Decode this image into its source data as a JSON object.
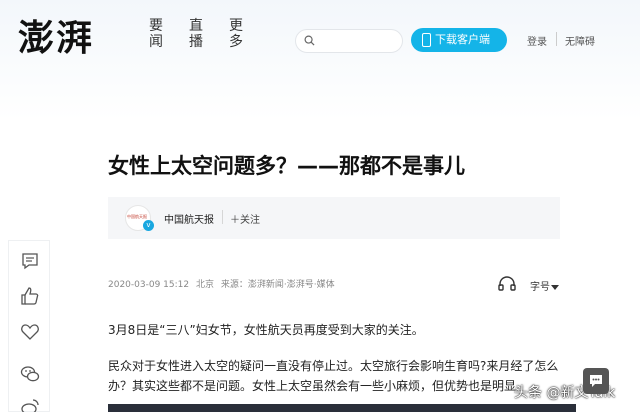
{
  "header": {
    "logo": "澎湃",
    "nav": [
      {
        "label": "要闻"
      },
      {
        "label": "直播"
      },
      {
        "label": "更多"
      }
    ],
    "search_placeholder": "",
    "download_label": "下载客户端",
    "login_label": "登录",
    "accessibility_label": "无障碍",
    "accent_color": "#14b4e8"
  },
  "article": {
    "title": "女性上太空问题多？——那都不是事儿",
    "author": {
      "name": "中国航天报",
      "avatar_text": "中国航天报",
      "follow_label": "关注"
    },
    "meta": {
      "datetime": "2020-03-09 15:12",
      "location": "北京",
      "source": "来源：澎湃新闻·澎湃号·媒体"
    },
    "font_size_label": "字号",
    "paragraphs": [
      "3月8日是“三八”妇女节，女性航天员再度受到大家的关注。",
      "民众对于女性进入太空的疑问一直没有停止过。太空旅行会影响生育吗?来月经了怎么办？其实这些都不是问题。女性上太空虽然会有一些小麻烦，但优势也是明显"
    ]
  },
  "sidebar": {
    "items": [
      {
        "icon": "comment-icon"
      },
      {
        "icon": "thumbs-up-icon"
      },
      {
        "icon": "heart-icon"
      },
      {
        "icon": "wechat-icon"
      },
      {
        "icon": "weibo-icon"
      }
    ]
  },
  "watermark": "头条 @新文Talk"
}
